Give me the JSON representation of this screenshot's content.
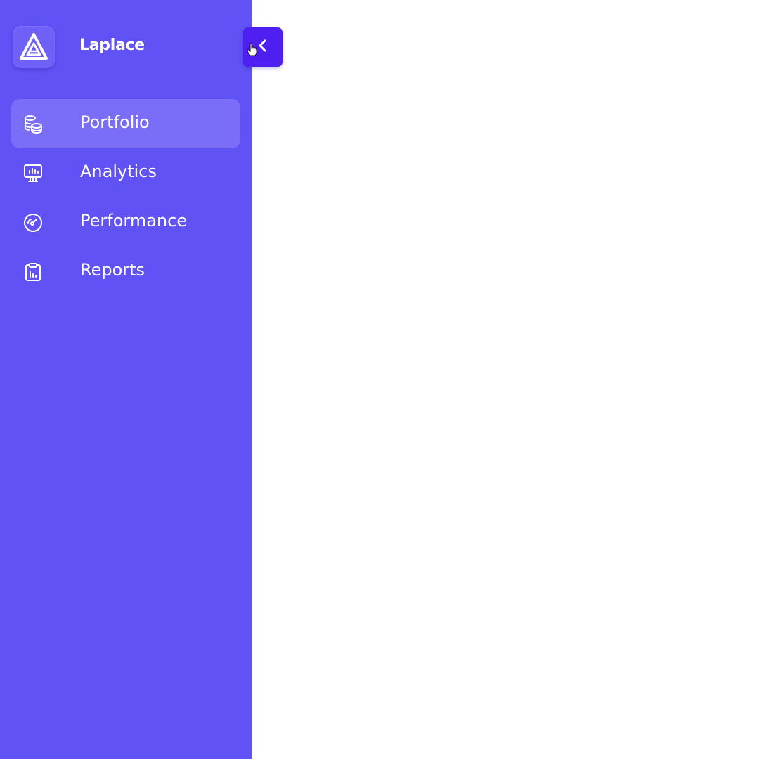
{
  "brand": {
    "name": "Laplace",
    "logo_icon": "triangle-logo-icon"
  },
  "nav": {
    "items": [
      {
        "label": "Portfolio",
        "icon": "coins-icon",
        "active": true
      },
      {
        "label": "Analytics",
        "icon": "presentation-chart-icon",
        "active": false
      },
      {
        "label": "Performance",
        "icon": "gauge-icon",
        "active": false
      },
      {
        "label": "Reports",
        "icon": "clipboard-chart-icon",
        "active": false
      }
    ]
  },
  "collapse_button": {
    "icon": "chevron-left-icon"
  },
  "colors": {
    "sidebar": "#6152f5",
    "active_item": "#7a6df7",
    "collapse_button": "#4e1ff0",
    "text": "#ffffff",
    "main_background": "#ffffff"
  }
}
